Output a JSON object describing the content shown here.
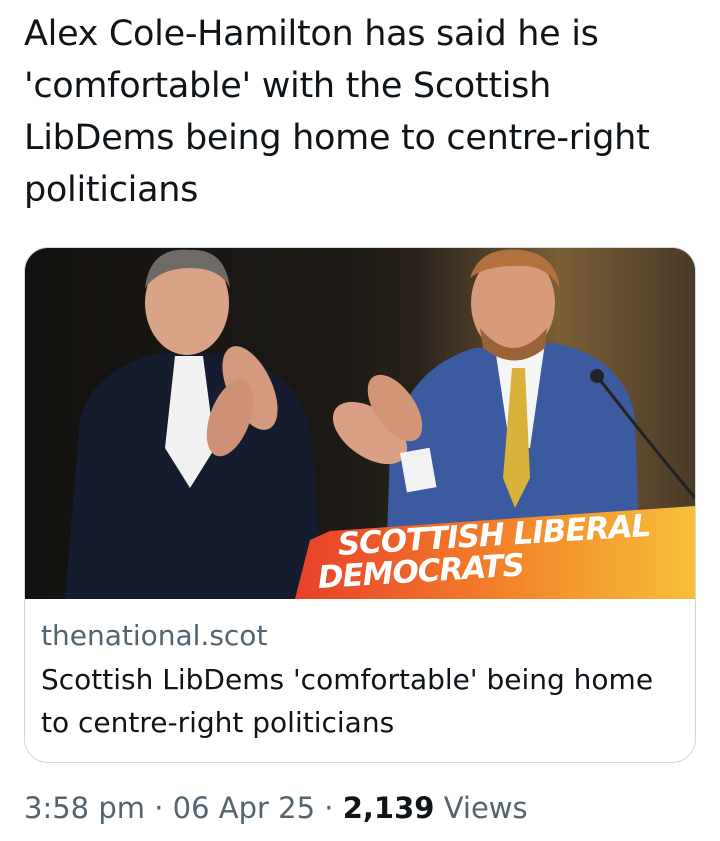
{
  "tweet": {
    "text": "Alex Cole-Hamilton has said he is 'comfortable' with the Scottish LibDems being home to centre-right politicians"
  },
  "card": {
    "banner_line1": "SCOTTISH LIBERAL",
    "banner_line2": "DEMOCRATS",
    "domain": "thenational.scot",
    "title": "Scottish LibDems 'comfortable' being home to centre-right politicians"
  },
  "meta": {
    "time": "3:58 pm",
    "separator": "·",
    "date": "06 Apr 25",
    "views_count": "2,139",
    "views_label": "Views"
  },
  "colors": {
    "text": "#0f1419",
    "secondary": "#536471",
    "border": "#cfd9de",
    "banner_start": "#e8402a",
    "banner_end": "#f6b41c"
  }
}
